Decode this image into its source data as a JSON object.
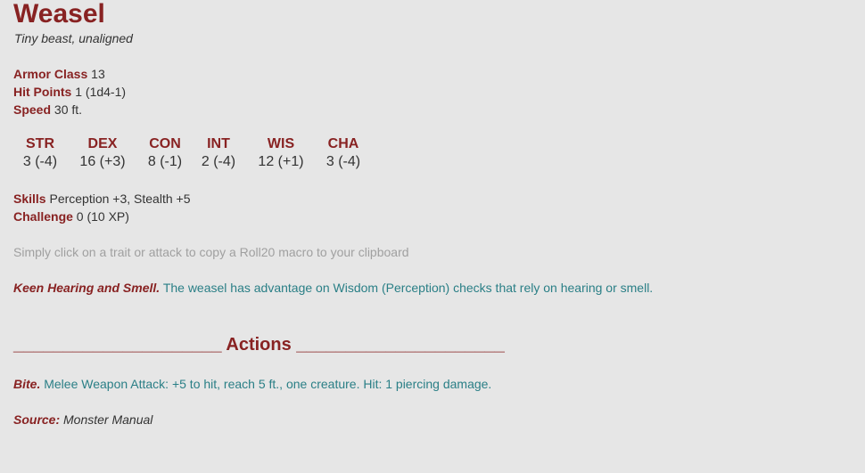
{
  "monster": {
    "name": "Weasel",
    "type_line": "Tiny beast, unaligned"
  },
  "properties": {
    "armor_class": {
      "label": "Armor Class",
      "value": "13"
    },
    "hit_points": {
      "label": "Hit Points",
      "value": "1 (1d4-1)"
    },
    "speed": {
      "label": "Speed",
      "value": "30 ft."
    }
  },
  "abilities": [
    {
      "abbr": "STR",
      "score": "3 (-4)"
    },
    {
      "abbr": "DEX",
      "score": "16 (+3)"
    },
    {
      "abbr": "CON",
      "score": "8 (-1)"
    },
    {
      "abbr": "INT",
      "score": "2 (-4)"
    },
    {
      "abbr": "WIS",
      "score": "12 (+1)"
    },
    {
      "abbr": "CHA",
      "score": "3 (-4)"
    }
  ],
  "extra": {
    "skills": {
      "label": "Skills",
      "value": "Perception +3, Stealth +5"
    },
    "challenge": {
      "label": "Challenge",
      "value": "0 (10 XP)"
    }
  },
  "hint": "Simply click on a trait or attack to copy a Roll20 macro to your clipboard",
  "traits": [
    {
      "name": "Keen Hearing and Smell.",
      "desc": "The weasel has advantage on Wisdom (Perception) checks that rely on hearing or smell."
    }
  ],
  "actions_header": "_____________________ Actions _____________________",
  "actions": [
    {
      "name": "Bite.",
      "desc": "Melee Weapon Attack: +5 to hit, reach 5 ft., one creature. Hit: 1 piercing damage."
    }
  ],
  "source": {
    "label": "Source:",
    "value": "Monster Manual"
  }
}
